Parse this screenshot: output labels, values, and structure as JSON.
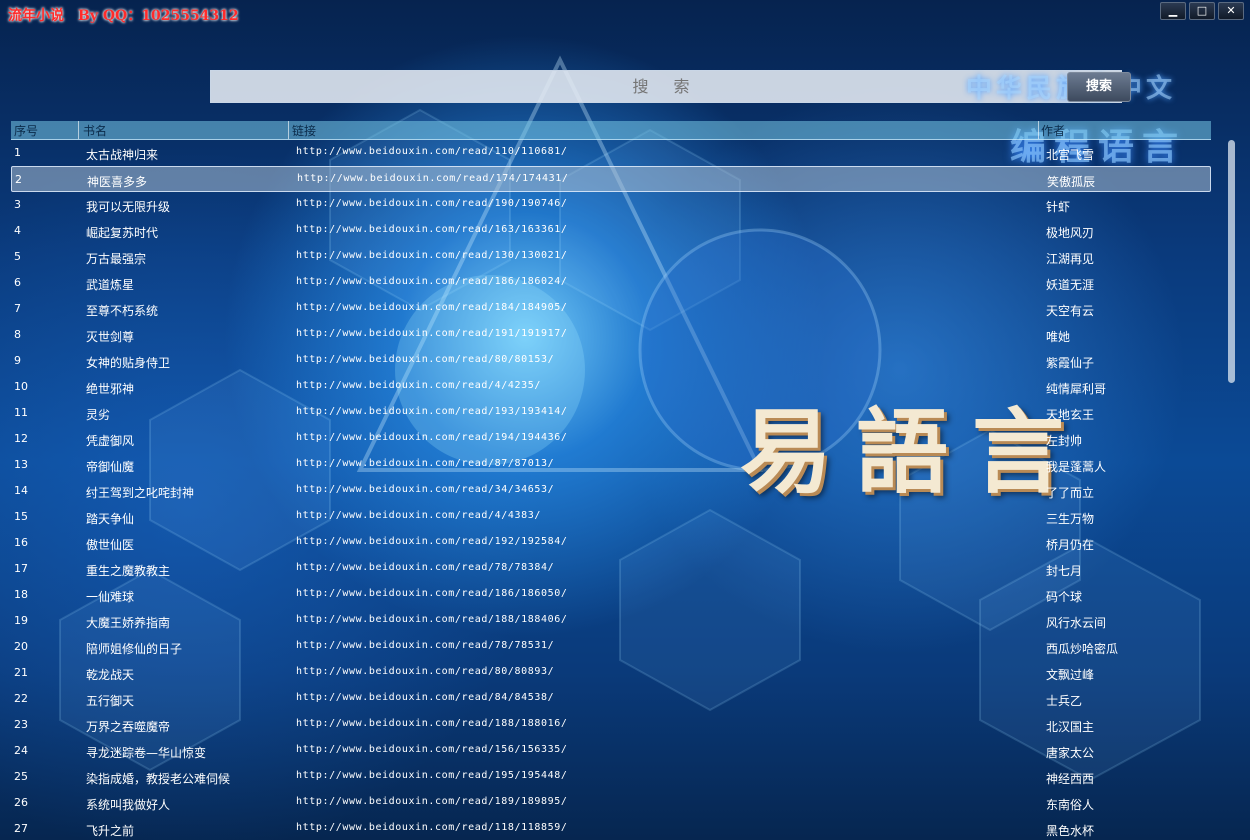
{
  "window": {
    "title": "流年小说",
    "by": "By QQ：1025554312",
    "minimize": "▁",
    "maximize": "□",
    "close": "✕"
  },
  "search": {
    "placeholder": "搜 索",
    "button": "搜索"
  },
  "watermark": {
    "line1": "中华民族全中文",
    "line2": "编程语言",
    "logo": "易語言"
  },
  "table": {
    "headers": [
      "序号",
      "书名",
      "链接",
      "作者"
    ],
    "selected_index": 1,
    "rows": [
      [
        "1",
        "太古战神归来",
        "http://www.beidouxin.com/read/110/110681/",
        "北宫飞雪"
      ],
      [
        "2",
        "神医喜多多",
        "http://www.beidouxin.com/read/174/174431/",
        "笑傲孤辰"
      ],
      [
        "3",
        "我可以无限升级",
        "http://www.beidouxin.com/read/190/190746/",
        "针虾"
      ],
      [
        "4",
        "崛起复苏时代",
        "http://www.beidouxin.com/read/163/163361/",
        "极地风刃"
      ],
      [
        "5",
        "万古最强宗",
        "http://www.beidouxin.com/read/130/130021/",
        "江湖再见"
      ],
      [
        "6",
        "武道炼星",
        "http://www.beidouxin.com/read/186/186024/",
        "妖道无涯"
      ],
      [
        "7",
        "至尊不朽系统",
        "http://www.beidouxin.com/read/184/184905/",
        "天空有云"
      ],
      [
        "8",
        "灭世剑尊",
        "http://www.beidouxin.com/read/191/191917/",
        "唯她"
      ],
      [
        "9",
        "女神的贴身侍卫",
        "http://www.beidouxin.com/read/80/80153/",
        "紫霞仙子"
      ],
      [
        "10",
        "绝世邪神",
        "http://www.beidouxin.com/read/4/4235/",
        "纯情犀利哥"
      ],
      [
        "11",
        "灵劣",
        "http://www.beidouxin.com/read/193/193414/",
        "天地玄王"
      ],
      [
        "12",
        "凭虚御风",
        "http://www.beidouxin.com/read/194/194436/",
        "左封帅"
      ],
      [
        "13",
        "帝御仙魔",
        "http://www.beidouxin.com/read/87/87013/",
        "我是蓬蒿人"
      ],
      [
        "14",
        "纣王驾到之叱咤封神",
        "http://www.beidouxin.com/read/34/34653/",
        "了了而立"
      ],
      [
        "15",
        "踏天争仙",
        "http://www.beidouxin.com/read/4/4383/",
        "三生万物"
      ],
      [
        "16",
        "傲世仙医",
        "http://www.beidouxin.com/read/192/192584/",
        "桥月仍在"
      ],
      [
        "17",
        "重生之魔教教主",
        "http://www.beidouxin.com/read/78/78384/",
        "封七月"
      ],
      [
        "18",
        "一仙难球",
        "http://www.beidouxin.com/read/186/186050/",
        "码个球"
      ],
      [
        "19",
        "大魔王娇养指南",
        "http://www.beidouxin.com/read/188/188406/",
        "风行水云间"
      ],
      [
        "20",
        "陪师姐修仙的日子",
        "http://www.beidouxin.com/read/78/78531/",
        "西瓜炒哈密瓜"
      ],
      [
        "21",
        "乾龙战天",
        "http://www.beidouxin.com/read/80/80893/",
        "文飘过峰"
      ],
      [
        "22",
        "五行御天",
        "http://www.beidouxin.com/read/84/84538/",
        "士兵乙"
      ],
      [
        "23",
        "万界之吞噬魔帝",
        "http://www.beidouxin.com/read/188/188016/",
        "北汉国主"
      ],
      [
        "24",
        "寻龙迷踪卷—华山惊变",
        "http://www.beidouxin.com/read/156/156335/",
        "唐家太公"
      ],
      [
        "25",
        "染指成婚，教授老公难伺候",
        "http://www.beidouxin.com/read/195/195448/",
        "神经西西"
      ],
      [
        "26",
        "系统叫我做好人",
        "http://www.beidouxin.com/read/189/189895/",
        "东南俗人"
      ],
      [
        "27",
        "飞升之前",
        "http://www.beidouxin.com/read/118/118859/",
        "黑色水杯"
      ]
    ]
  },
  "scroll": {
    "position_fraction": 0.0,
    "visible_fraction": 0.36
  }
}
